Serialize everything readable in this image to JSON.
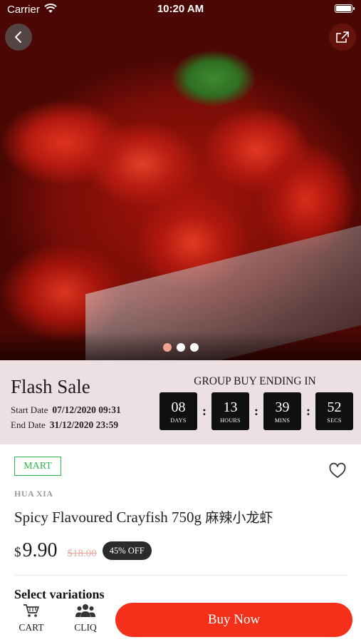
{
  "status_bar": {
    "carrier": "Carrier",
    "time": "10:20 AM"
  },
  "hero": {
    "carousel_total": 3,
    "carousel_active_index": 0
  },
  "flash_sale": {
    "title": "Flash Sale",
    "start_label": "Start Date",
    "start_value": "07/12/2020 09:31",
    "end_label": "End Date",
    "end_value": "31/12/2020 23:59",
    "group_buy_title": "GROUP BUY ENDING IN",
    "timer": [
      {
        "value": "08",
        "unit": "DAYS"
      },
      {
        "value": "13",
        "unit": "HOURS"
      },
      {
        "value": "39",
        "unit": "MINS"
      },
      {
        "value": "52",
        "unit": "SECS"
      }
    ],
    "separator": ":"
  },
  "product": {
    "badge": "MART",
    "brand": "HUA XIA",
    "name": "Spicy Flavoured Crayfish 750g",
    "name_zh": "麻辣小龙虾",
    "currency": "$",
    "price": "9.90",
    "old_price": "$18.00",
    "discount": "45% OFF",
    "variations_title": "Select variations"
  },
  "bottom_bar": {
    "cart_label": "CART",
    "cliq_label": "CLIQ",
    "buy_label": "Buy Now"
  },
  "colors": {
    "accent": "#f5301a",
    "mart_green": "#2eb64f",
    "flash_bg": "#ece0e2"
  }
}
